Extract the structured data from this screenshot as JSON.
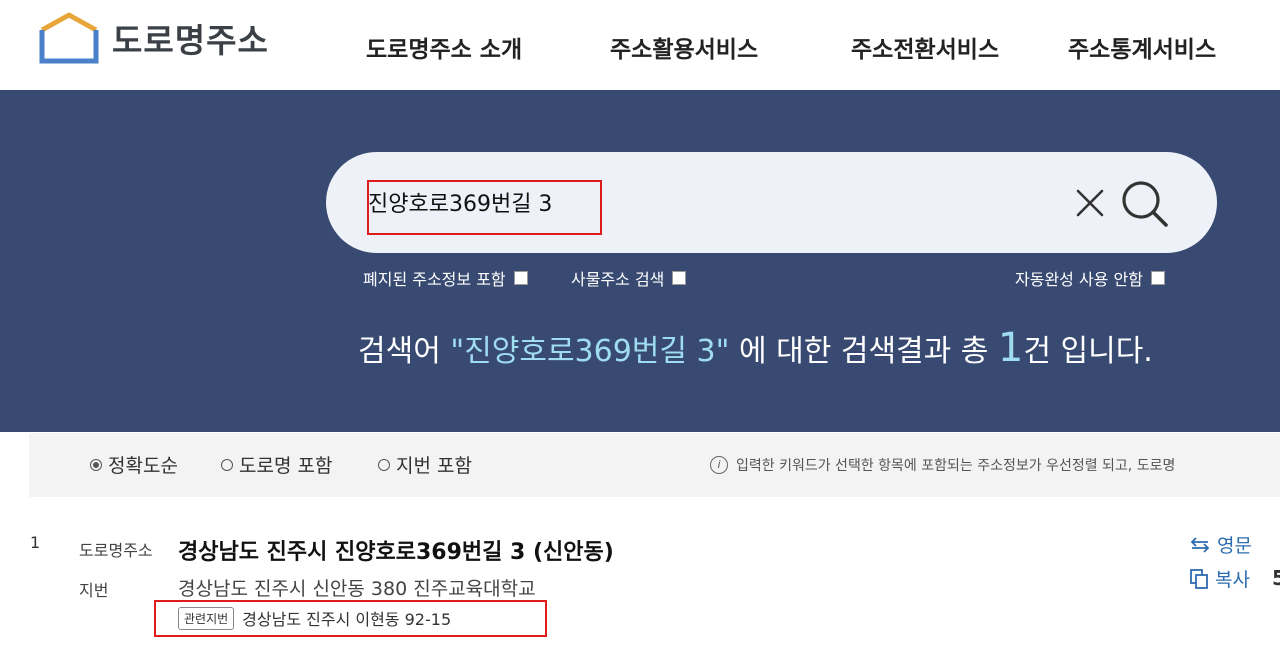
{
  "header": {
    "logo_text": "도로명주소",
    "nav": [
      "도로명주소 소개",
      "주소활용서비스",
      "주소전환서비스",
      "주소통계서비스"
    ]
  },
  "search": {
    "value": "진양호로369번길 3",
    "options": {
      "abolished": "폐지된 주소정보 포함",
      "object": "사물주소 검색",
      "autocomplete": "자동완성 사용 안함"
    },
    "summary_prefix": "검색어 ",
    "summary_query": "\"진양호로369번길 3\"",
    "summary_mid": " 에 대한 검색결과 총 ",
    "summary_count": "1",
    "summary_suffix": "건 입니다."
  },
  "filters": {
    "items": [
      "정확도순",
      "도로명 포함",
      "지번 포함"
    ],
    "selected": "정확도순",
    "info_text": "입력한 키워드가 선택한 항목에 포함되는 주소정보가 우선정렬 되고, 도로명"
  },
  "result": {
    "number": "1",
    "road_label": "도로명주소",
    "road_address": "경상남도 진주시 진양호로369번길 3 (신안동)",
    "jibun_label": "지번",
    "jibun_address": "경상남도 진주시 신안동 380 진주교육대학교",
    "related_badge": "관련지번",
    "related_address": "경상남도 진주시 이현동 92-15",
    "actions": {
      "english": "영문",
      "copy": "복사"
    },
    "edge_char": "5"
  },
  "colors": {
    "hero_bg": "#384a72",
    "highlight": "#e01b1b",
    "link": "#2c6cb0",
    "accent_text": "#9fdcf0"
  }
}
